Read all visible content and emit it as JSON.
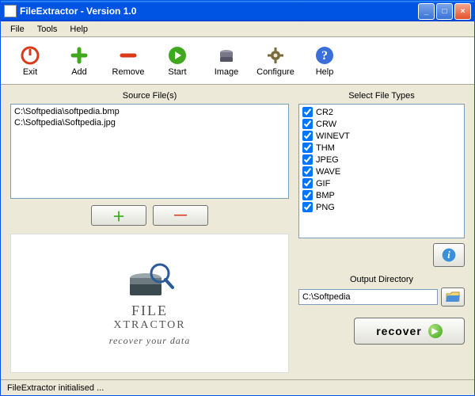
{
  "window": {
    "title": "FileExtractor - Version 1.0"
  },
  "menu": {
    "file": "File",
    "tools": "Tools",
    "help": "Help"
  },
  "toolbar": {
    "exit": "Exit",
    "add": "Add",
    "remove": "Remove",
    "start": "Start",
    "image": "Image",
    "configure": "Configure",
    "help": "Help"
  },
  "source": {
    "label": "Source File(s)",
    "files": [
      "C:\\Softpedia\\softpedia.bmp",
      "C:\\Softpedia\\Softpedia.jpg"
    ]
  },
  "filetypes": {
    "label": "Select File Types",
    "items": [
      {
        "label": "CR2",
        "checked": true
      },
      {
        "label": "CRW",
        "checked": true
      },
      {
        "label": "WINEVT",
        "checked": true
      },
      {
        "label": "THM",
        "checked": true
      },
      {
        "label": "JPEG",
        "checked": true
      },
      {
        "label": "WAVE",
        "checked": true
      },
      {
        "label": "GIF",
        "checked": true
      },
      {
        "label": "BMP",
        "checked": true
      },
      {
        "label": "PNG",
        "checked": true
      }
    ]
  },
  "output": {
    "label": "Output Directory",
    "value": "C:\\Softpedia"
  },
  "logo": {
    "title": "FILE",
    "title2": "XTRACTOR",
    "sub": "recover your data"
  },
  "recover": {
    "label": "recover"
  },
  "status": {
    "text": "FileExtractor initialised ..."
  }
}
